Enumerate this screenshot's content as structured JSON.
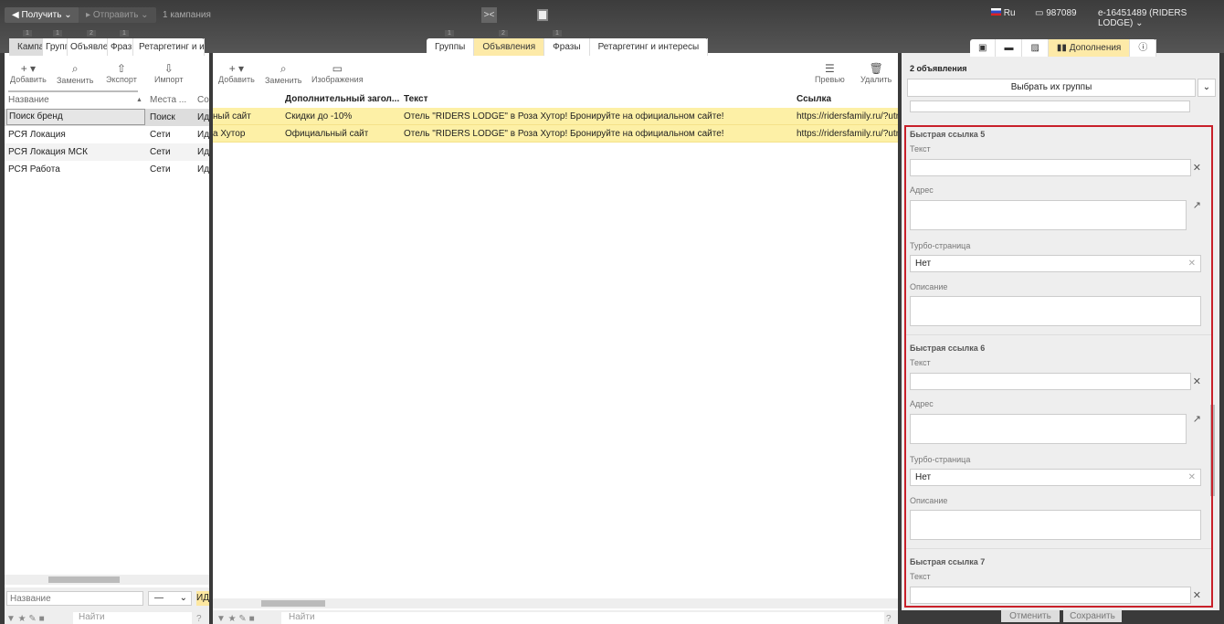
{
  "topbar": {
    "get": "Получить",
    "send": "Отправить",
    "campaigns": "1 кампания",
    "lang": "Ru",
    "balance": "987089",
    "account": "e-16451489 (RIDERS LODGE)"
  },
  "left": {
    "badges": [
      "1",
      "1",
      "2",
      "1"
    ],
    "tabs": [
      "Кампании",
      "Группы",
      "Объявления",
      "Фразы",
      "Ретаргетинг и интересы"
    ],
    "tools": [
      "Добавить",
      "Заменить",
      "Экспорт",
      "Импорт"
    ],
    "columns": [
      "Название",
      "Места ...",
      "Со"
    ],
    "rows": [
      [
        "Поиск бренд",
        "Поиск",
        "Иду"
      ],
      [
        "РСЯ Локация",
        "Сети",
        "Иду"
      ],
      [
        "РСЯ Локация МСК",
        "Сети",
        "Иду"
      ],
      [
        "РСЯ Работа",
        "Сети",
        "Иду"
      ]
    ],
    "name_placeholder": "Название",
    "select": "—",
    "status_btn": "ИД",
    "search_placeholder": "Найти",
    "help": "?"
  },
  "middle": {
    "badges": [
      "1",
      "2",
      "1"
    ],
    "tabs": [
      "Группы",
      "Объявления",
      "Фразы",
      "Ретаргетинг и интересы"
    ],
    "tools": [
      "Добавить",
      "Заменить",
      "Изображения"
    ],
    "preview": "Превью",
    "delete": "Удалить",
    "columns": [
      "Дополнительный загол...",
      "Текст",
      "Ссылка"
    ],
    "rows": [
      [
        "ный сайт",
        "Скидки до -10%",
        "Отель \"RIDERS LODGE\" в Роза Хутор! Бронируйте на официальном сайте!",
        "https://ridersfamily.ru/?utm_"
      ],
      [
        "а Хутор",
        "Официальный сайт",
        "Отель \"RIDERS LODGE\" в Роза Хутор! Бронируйте на официальном сайте!",
        "https://ridersfamily.ru/?utm_"
      ]
    ],
    "search_placeholder": "Найти",
    "help": "?"
  },
  "right": {
    "tab_active": "Дополнения",
    "count": "2 объявления",
    "select_groups": "Выбрать их группы",
    "sections": [
      {
        "title": "Быстрая ссылка 5",
        "text": "Текст",
        "address": "Адрес",
        "turbo": "Турбо-страница",
        "turbo_value": "Нет",
        "description": "Описание"
      },
      {
        "title": "Быстрая ссылка 6",
        "text": "Текст",
        "address": "Адрес",
        "turbo": "Турбо-страница",
        "turbo_value": "Нет",
        "description": "Описание"
      },
      {
        "title": "Быстрая ссылка 7",
        "text": "Текст"
      }
    ],
    "cancel": "Отменить",
    "save": "Сохранить"
  }
}
